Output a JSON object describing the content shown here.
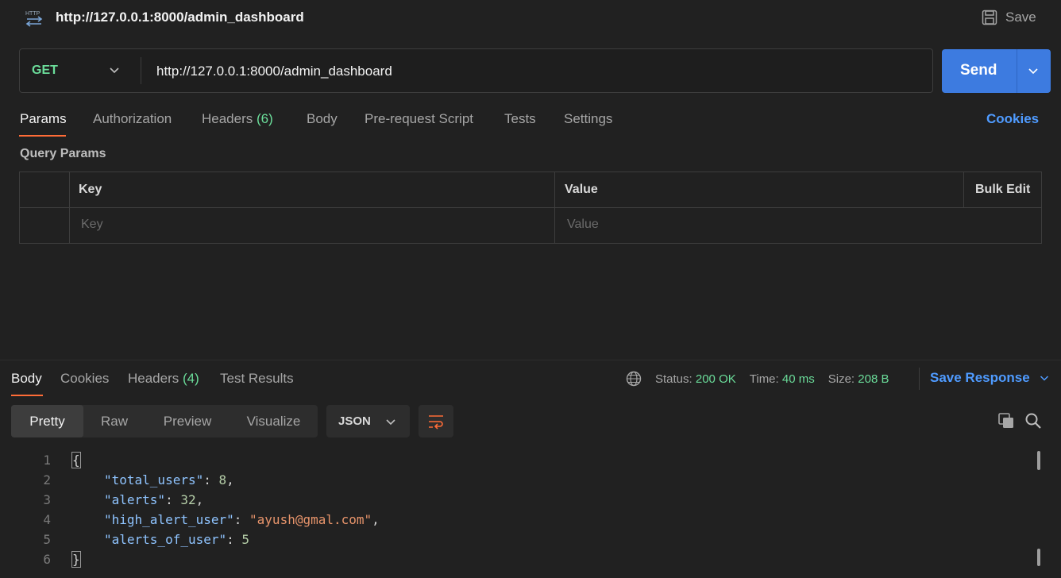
{
  "tab": {
    "url": "http://127.0.0.1:8000/admin_dashboard",
    "save_label": "Save",
    "icon": "http-icon"
  },
  "request": {
    "method": "GET",
    "url": "http://127.0.0.1:8000/admin_dashboard",
    "send_label": "Send",
    "tabs": [
      {
        "label": "Params"
      },
      {
        "label": "Authorization"
      },
      {
        "label": "Headers",
        "count": "(6)"
      },
      {
        "label": "Body"
      },
      {
        "label": "Pre-request Script"
      },
      {
        "label": "Tests"
      },
      {
        "label": "Settings"
      }
    ],
    "cookies_label": "Cookies"
  },
  "params": {
    "title": "Query Params",
    "col_key": "Key",
    "col_value": "Value",
    "bulk_edit": "Bulk Edit",
    "key_placeholder": "Key",
    "value_placeholder": "Value"
  },
  "response": {
    "tabs": [
      {
        "label": "Body"
      },
      {
        "label": "Cookies"
      },
      {
        "label": "Headers",
        "count": "(4)"
      },
      {
        "label": "Test Results"
      }
    ],
    "status_label": "Status:",
    "status_value": "200 OK",
    "time_label": "Time:",
    "time_value": "40 ms",
    "size_label": "Size:",
    "size_value": "208 B",
    "save_response": "Save Response",
    "view_tabs": [
      "Pretty",
      "Raw",
      "Preview",
      "Visualize"
    ],
    "format": "JSON",
    "code_lines": [
      {
        "n": "1",
        "text": "{"
      },
      {
        "n": "2",
        "key": "\"total_users\"",
        "value": "8",
        "trail": ","
      },
      {
        "n": "3",
        "key": "\"alerts\"",
        "value": "32",
        "trail": ","
      },
      {
        "n": "4",
        "key": "\"high_alert_user\"",
        "value": "\"ayush@gmal.com\"",
        "trail": ","
      },
      {
        "n": "5",
        "key": "\"alerts_of_user\"",
        "value": "5",
        "trail": ""
      },
      {
        "n": "6",
        "text": "}"
      }
    ]
  },
  "colors": {
    "accent": "#ff6c37",
    "send": "#3d7be0",
    "link": "#4f9bff",
    "ok": "#6bdd9a"
  }
}
